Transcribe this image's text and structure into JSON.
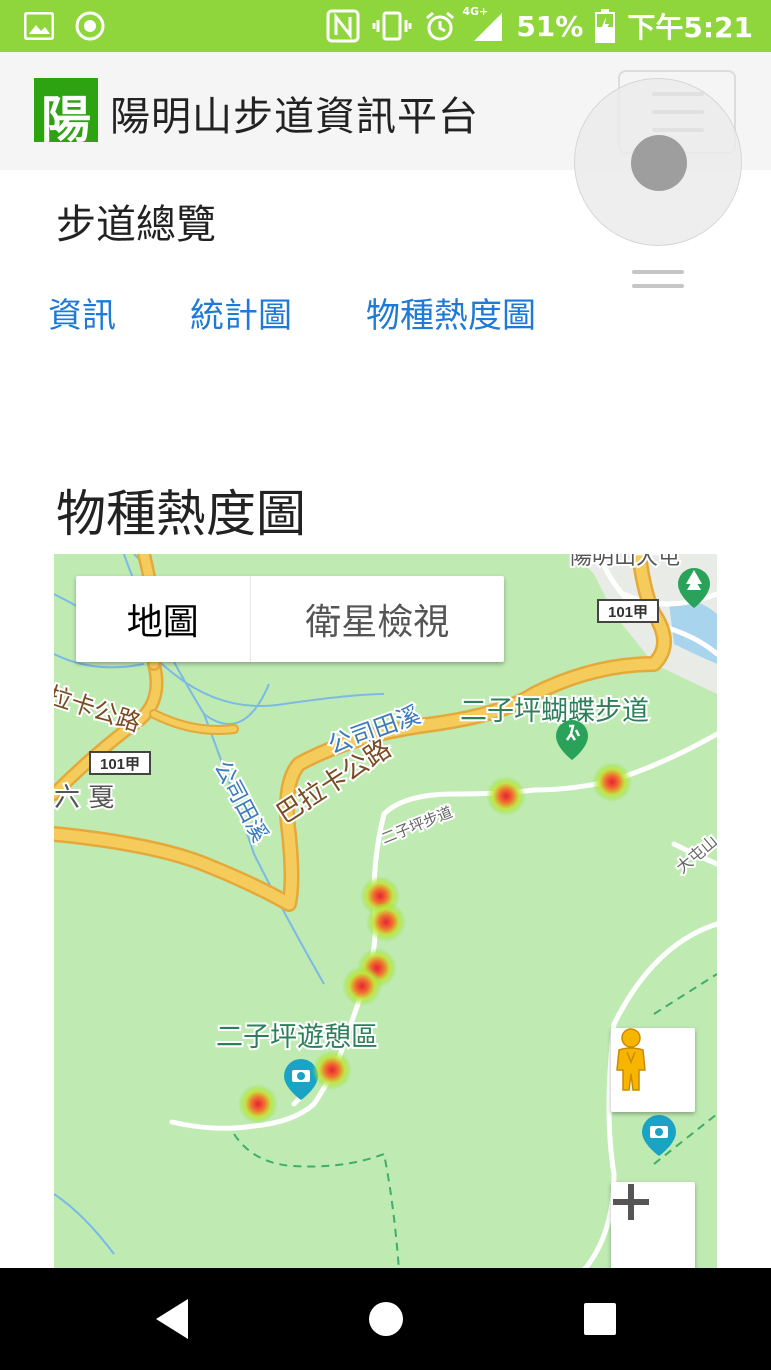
{
  "status": {
    "network": "4G+",
    "battery": "51%",
    "time": "下午5:21"
  },
  "header": {
    "logo_text": "陽",
    "title": "陽明山步道資訊平台"
  },
  "section_title": "步道總覽",
  "tabs": [
    {
      "label": "資訊"
    },
    {
      "label": "統計圖"
    },
    {
      "label": "物種熱度圖"
    }
  ],
  "heatmap_title": "物種熱度圖",
  "map": {
    "type_controls": {
      "map": "地圖",
      "satellite": "衛星檢視"
    },
    "labels": {
      "top_place": "陽明山大屯",
      "road_a": "101甲",
      "road_b": "101甲",
      "balaka_left": "拉卡公路",
      "balaka_main": "巴拉卡公路",
      "liuxia": "六 戛",
      "creek_1": "公司田溪",
      "creek_2": "公司田溪",
      "butterfly_trail": "二子坪蝴蝶步道",
      "erziping_trail": "二子坪步道",
      "rest_area": "二子坪遊憩區",
      "datun": "大屯山"
    },
    "colors": {
      "land": "#bfeab2",
      "road": "#f5cc5c",
      "road_edge": "#e5a93a",
      "water": "#7cb9e6",
      "trail": "#ffffff",
      "heat_outer": "#8be33a",
      "heat_inner": "#e6203a"
    }
  },
  "icons": [
    "picture-icon",
    "record-icon",
    "nfc-icon",
    "vibrate-icon",
    "alarm-icon",
    "signal-icon",
    "battery-icon",
    "hamburger-icon",
    "hiker-icon",
    "park-icon",
    "camera-pin-icon",
    "pegman-icon",
    "zoom-in-icon",
    "back-icon",
    "home-icon",
    "recents-icon"
  ]
}
